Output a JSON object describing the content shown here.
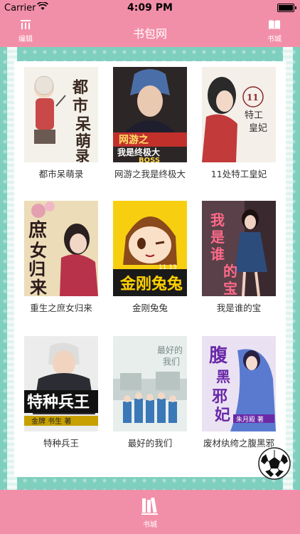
{
  "status_bar": {
    "carrier": "Carrier",
    "time": "4:09 PM"
  },
  "nav": {
    "title": "书包网",
    "left_button": "编辑",
    "right_button": "书城",
    "left_icon": "list-icon",
    "right_icon": "book-open-icon"
  },
  "books": [
    {
      "title": "都市呆萌录",
      "cover_text": "都市呆萌录",
      "cover_color": "#f4f1ea"
    },
    {
      "title": "网游之我是终极大",
      "cover_text": "网游之我是终极大BOSS",
      "cover_color": "#3a3030"
    },
    {
      "title": "11处特工皇妃",
      "cover_text": "11处特工皇妃",
      "cover_color": "#f2ece6"
    },
    {
      "title": "重生之庶女归来",
      "cover_text": "庶女归来",
      "cover_color": "#e8d7b0"
    },
    {
      "title": "金刚兔兔",
      "cover_text": "金刚兔兔",
      "cover_color": "#f7c900"
    },
    {
      "title": "我是谁的宝",
      "cover_text": "我是谁的宝",
      "cover_color": "#4a3a40"
    },
    {
      "title": "特种兵王",
      "cover_text": "特种兵王",
      "cover_color": "#e9e9e9"
    },
    {
      "title": "最好的我们",
      "cover_text": "最好的我们",
      "cover_color": "#e5ecea"
    },
    {
      "title": "废材纨绔之腹黑邪",
      "cover_text": "腹黑邪妃",
      "cover_color": "#e8e0f0"
    }
  ],
  "tab_bar": {
    "label": "书城",
    "icon": "books-icon"
  },
  "floating": {
    "icon": "soccer-ball-icon"
  }
}
